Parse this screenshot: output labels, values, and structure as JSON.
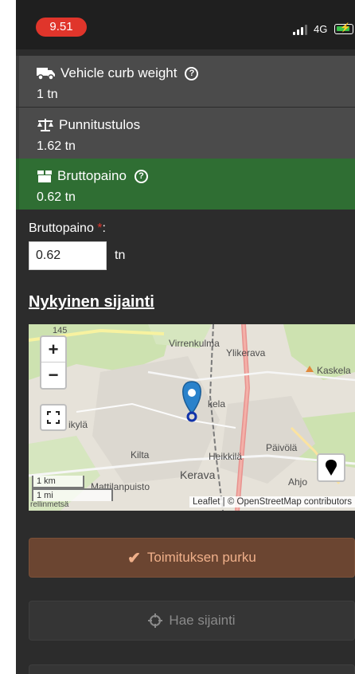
{
  "status_bar": {
    "time": "9.51",
    "network": "4G"
  },
  "cards": [
    {
      "icon": "truck-icon",
      "title": "Vehicle curb weight",
      "has_help": true,
      "value": "1 tn"
    },
    {
      "icon": "scale-icon",
      "title": "Punnitustulos",
      "has_help": false,
      "value": "1.62 tn"
    },
    {
      "icon": "box-icon",
      "title": "Bruttopaino",
      "has_help": true,
      "value": "0.62 tn"
    }
  ],
  "form": {
    "label": "Bruttopaino",
    "required_mark": "*",
    "label_suffix": ":",
    "value": "0.62",
    "unit": "tn"
  },
  "location": {
    "title": "Nykyinen sijainti"
  },
  "map": {
    "zoom_in": "+",
    "zoom_out": "−",
    "labels": {
      "road_number": "145",
      "virrenkulma": "Virrenkulma",
      "ylikerava": "Ylikerava",
      "kaskela": "Kaskela",
      "kela": "kela",
      "kyla": "ikylä",
      "kilta": "Kilta",
      "heikkila": "Heikkilä",
      "paivola": "Päivölä",
      "kerava": "Kerava",
      "ahjo": "Ahjo",
      "mattilanpuisto": "Mattilanpuisto",
      "rellinmetsa": "rellinmetsä"
    },
    "scale_km": "1 km",
    "scale_mi": "1 mi",
    "attribution": "Leaflet | © OpenStreetMap contributors",
    "colors": {
      "marker": "#2a82cb",
      "water": "#aad3df",
      "park": "#c8dfa8"
    }
  },
  "buttons": {
    "unload": "Toimituksen purku",
    "get_location": "Hae sijainti"
  },
  "colors": {
    "accent_green": "#2f6e33",
    "primary_button": "#6b4531",
    "required": "#e0352b"
  }
}
